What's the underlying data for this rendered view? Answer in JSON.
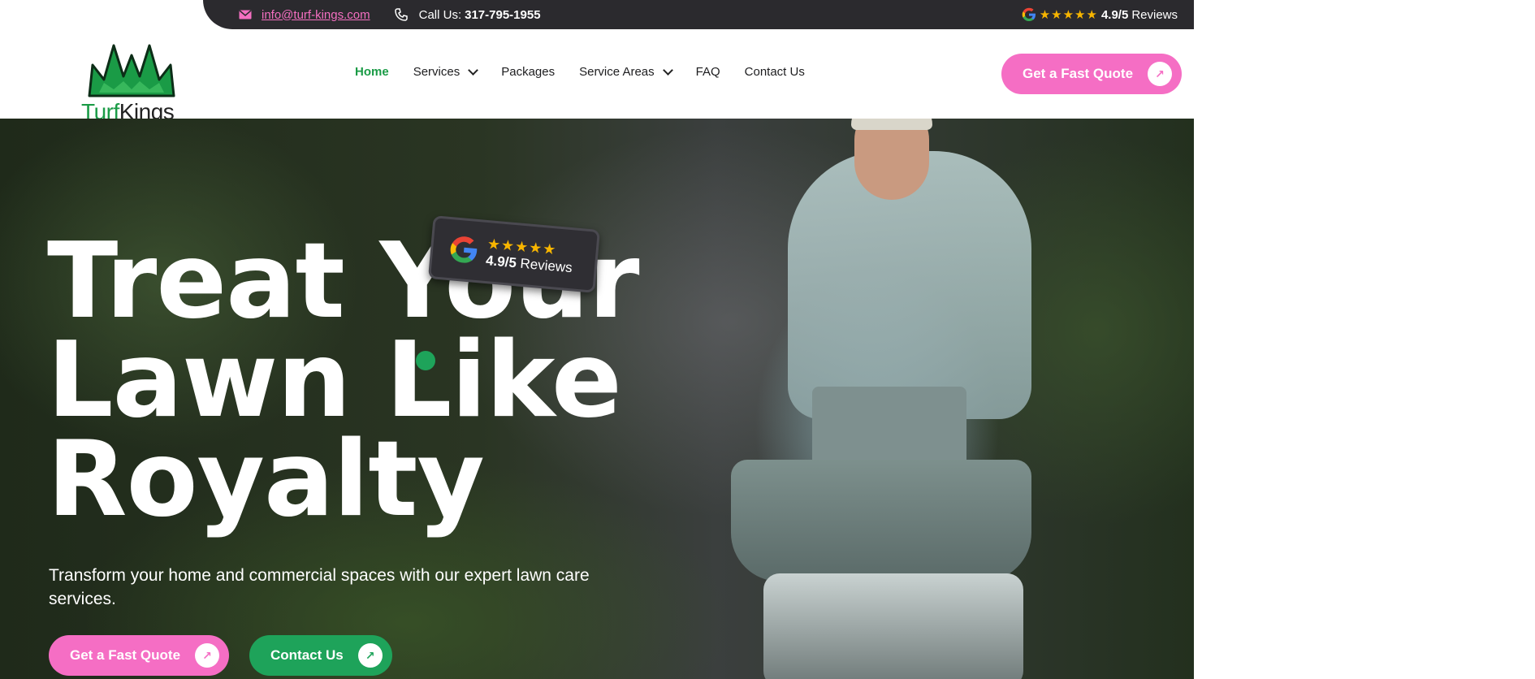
{
  "topbar": {
    "email": "info@turf-kings.com",
    "phone_label": "Call Us:",
    "phone_number": "317-795-1955",
    "rating_stars": "★★★★★",
    "rating_score": "4.9/5",
    "rating_suffix": "Reviews"
  },
  "logo": {
    "word_left": "Turf",
    "word_right": "Kings"
  },
  "nav": {
    "items": [
      {
        "label": "Home"
      },
      {
        "label": "Services"
      },
      {
        "label": "Packages"
      },
      {
        "label": "Service Areas"
      },
      {
        "label": "FAQ"
      },
      {
        "label": "Contact Us"
      }
    ]
  },
  "header": {
    "quote_label": "Get a Fast Quote",
    "arrow": "↗"
  },
  "hero": {
    "title_line1": "Treat Your",
    "title_line2": "Lawn Like",
    "title_line3": "Royalty",
    "subtitle": "Transform your home and commercial spaces with our expert lawn care services.",
    "cta_primary": "Get a Fast Quote",
    "cta_secondary": "Contact Us",
    "arrow": "↗",
    "badge": {
      "stars": "★★★★★",
      "score": "4.9/5",
      "suffix": "Reviews"
    }
  },
  "colors": {
    "brand_green": "#1ea35a",
    "brand_pink": "#f56ec4",
    "topbar_bg": "#2b2a2e",
    "star": "#f7b500"
  },
  "icons": [
    "mail-icon",
    "phone-icon",
    "google-icon",
    "star-icon",
    "chevron-down-icon",
    "arrow-up-right-icon",
    "logo-grass-crown"
  ]
}
